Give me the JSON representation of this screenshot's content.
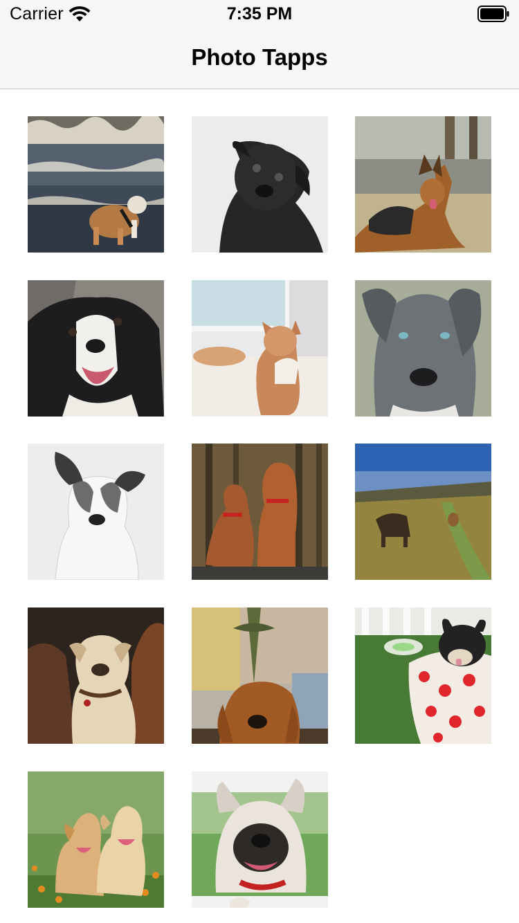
{
  "status_bar": {
    "carrier": "Carrier",
    "time": "7:35 PM",
    "icons": [
      "wifi-icon",
      "battery-icon"
    ]
  },
  "nav_bar": {
    "title": "Photo Tapps"
  },
  "photos": [
    {
      "subject": "bulldog-beach-photo"
    },
    {
      "subject": "black-pug-photo"
    },
    {
      "subject": "german-shepherd-photo"
    },
    {
      "subject": "border-collie-photo"
    },
    {
      "subject": "shiba-inu-photo"
    },
    {
      "subject": "grey-pitbull-photo"
    },
    {
      "subject": "white-terrier-photo"
    },
    {
      "subject": "vizsla-pair-photo"
    },
    {
      "subject": "field-dogs-photo"
    },
    {
      "subject": "three-boxers-photo"
    },
    {
      "subject": "golden-retriever-photo"
    },
    {
      "subject": "puppy-in-cup-photo"
    },
    {
      "subject": "golden-puppies-photo"
    },
    {
      "subject": "french-bulldog-photo"
    }
  ]
}
